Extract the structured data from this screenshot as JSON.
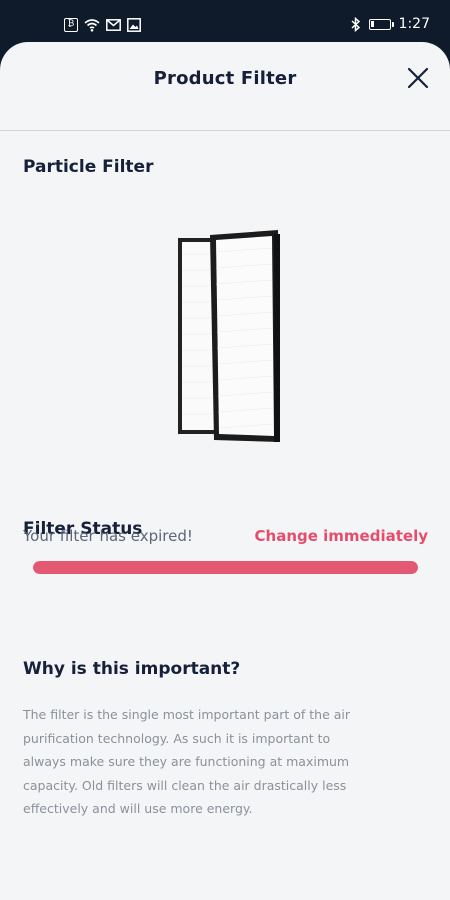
{
  "status_bar": {
    "time": "1:27",
    "battery_fraction": 0.2,
    "left_icons": [
      "battery-saver-icon",
      "wifi-icon",
      "mail-icon",
      "image-icon"
    ],
    "right_icons": [
      "bluetooth-icon",
      "battery-icon"
    ]
  },
  "header": {
    "title": "Product Filter",
    "close_icon": "close-icon"
  },
  "product": {
    "section_title": "Particle Filter",
    "image_icon": "air-filter-image"
  },
  "filter_status": {
    "title": "Filter Status",
    "message": "Your filter has expired!",
    "action": "Change immediately",
    "progress_fraction": 1.0,
    "accent_color": "#e84c6c"
  },
  "info": {
    "title": "Why is this important?",
    "body": "The filter is the single most important part of the air purification technology. As such it is important to always make sure they are functioning at maximum capacity. Old filters will clean the air drastically less effectively and will use more energy."
  }
}
